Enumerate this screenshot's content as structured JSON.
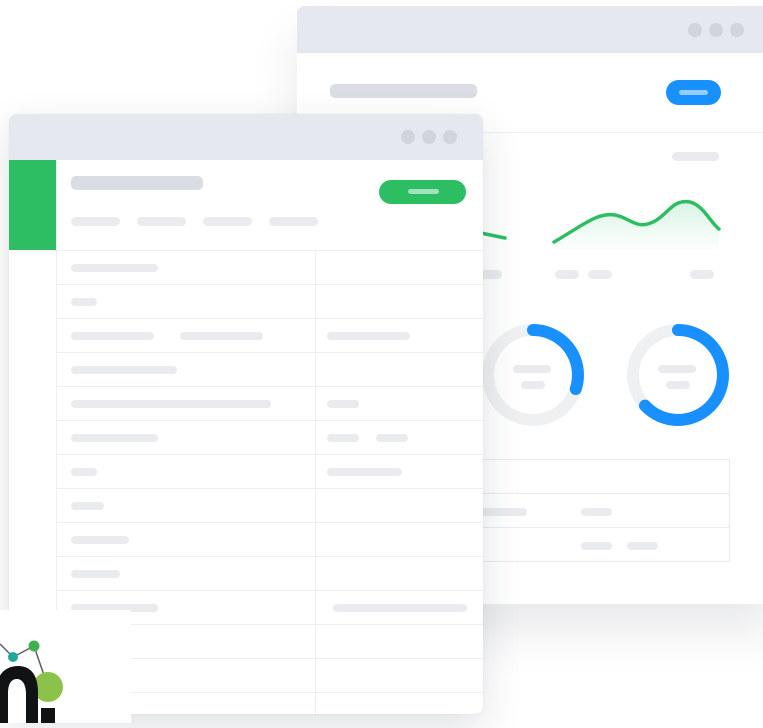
{
  "colors": {
    "accent_green": "#2dbe64",
    "accent_blue": "#1890ff",
    "titlebar": "#e6e8ef",
    "placeholder": "#e9ebef"
  },
  "icons": {
    "window_controls": "three-dots-icon",
    "line_chart": "line-chart-icon",
    "gauges": "donut-gauge-icon",
    "logo": "network-nodes-logo-icon"
  },
  "back_window": {
    "gauges": [
      {
        "fill": 0.3
      },
      {
        "fill": 0.63
      }
    ]
  },
  "front_window": {
    "row_count": 13
  }
}
